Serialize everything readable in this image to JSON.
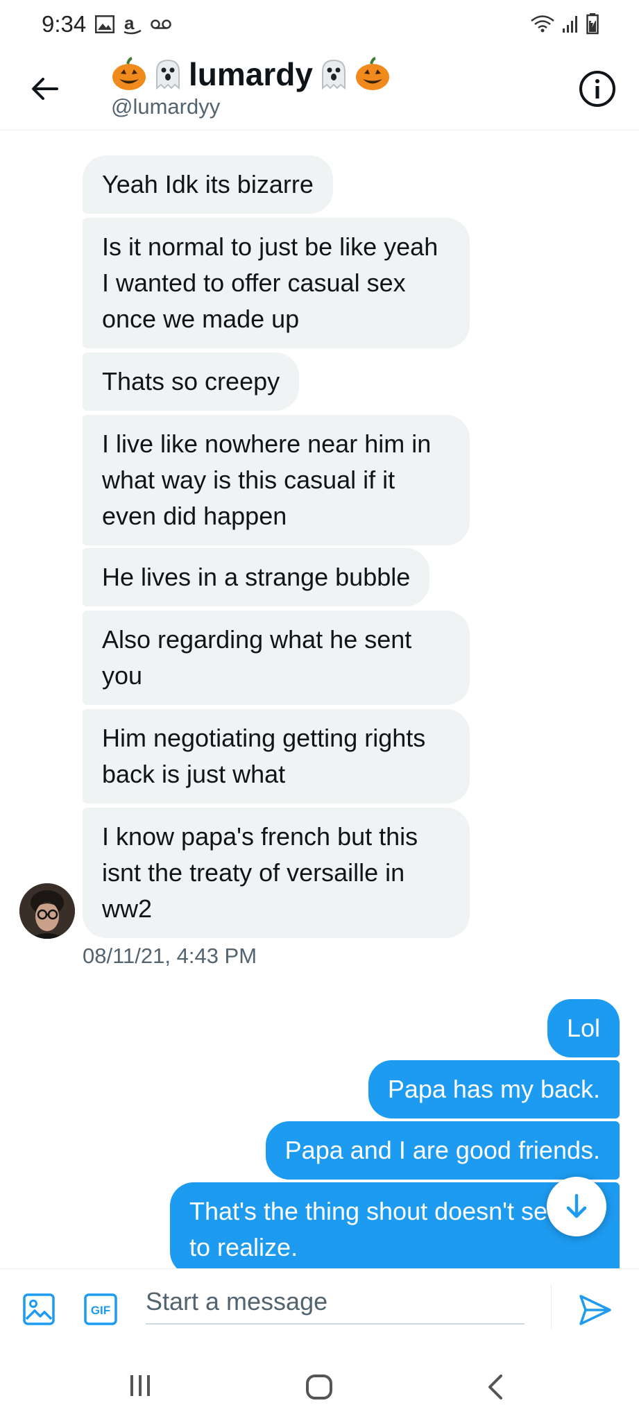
{
  "status_bar": {
    "time": "9:34",
    "left_icons": [
      "image-notification-icon",
      "amazon-icon",
      "voicemail-icon"
    ],
    "right_icons": [
      "wifi-icon",
      "signal-icon",
      "battery-icon"
    ]
  },
  "header": {
    "title": "lumardy",
    "title_emojis": [
      "jack-o-lantern-emoji",
      "ghost-emoji",
      "ghost-emoji",
      "jack-o-lantern-emoji"
    ],
    "handle": "@lumardyy"
  },
  "messages": {
    "incoming": [
      "Yeah Idk its bizarre",
      "Is it normal to just be like yeah I wanted to offer casual sex once we made up",
      "Thats so creepy",
      "I live like nowhere near him in what way is this casual if it even did happen",
      "He lives in a strange bubble",
      "Also regarding what he sent you",
      "Him negotiating getting rights back is just what",
      "I know papa's french but this isnt the treaty of versaille in ww2"
    ],
    "incoming_timestamp": "08/11/21, 4:43 PM",
    "outgoing": [
      "Lol",
      "Papa has my back.",
      "Papa and I are good friends.",
      "That's the thing shout doesn't seem to realize."
    ]
  },
  "composer": {
    "placeholder": "Start a message",
    "gif_label": "GIF"
  },
  "colors": {
    "accent": "#1d9bf0",
    "incoming_bubble": "#eff3f4",
    "secondary_text": "#536471"
  }
}
